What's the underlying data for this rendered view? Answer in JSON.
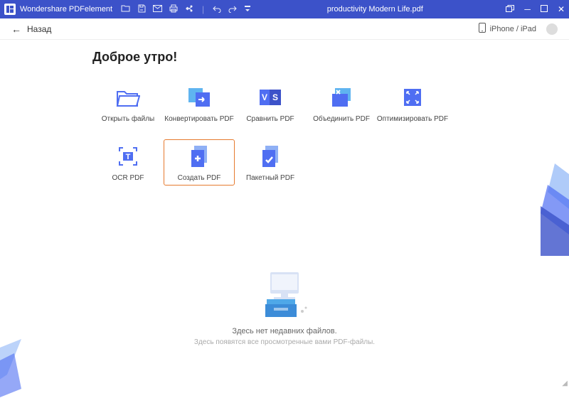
{
  "titlebar": {
    "appname": "Wondershare PDFelement",
    "filename": "productivity Modern Life.pdf"
  },
  "toprow": {
    "back_label": "Назад",
    "device_label": "iPhone / iPad"
  },
  "greeting": "Доброе утро!",
  "tiles": [
    {
      "label": "Открыть файлы",
      "icon": "folder-open-icon"
    },
    {
      "label": "Конвертировать PDF",
      "icon": "convert-icon"
    },
    {
      "label": "Сравнить PDF",
      "icon": "compare-icon"
    },
    {
      "label": "Объединить PDF",
      "icon": "merge-icon"
    },
    {
      "label": "Оптимизировать PDF",
      "icon": "optimize-icon"
    },
    {
      "label": "OCR PDF",
      "icon": "ocr-icon"
    },
    {
      "label": "Создать PDF",
      "icon": "create-icon",
      "selected": true
    },
    {
      "label": "Пакетный PDF",
      "icon": "batch-icon"
    }
  ],
  "empty": {
    "title": "Здесь нет недавних файлов.",
    "subtitle": "Здесь появятся все просмотренные вами PDF-файлы."
  },
  "colors": {
    "brand": "#3c52c9",
    "accent": "#4f6ef2",
    "orange": "#e67a2e"
  }
}
